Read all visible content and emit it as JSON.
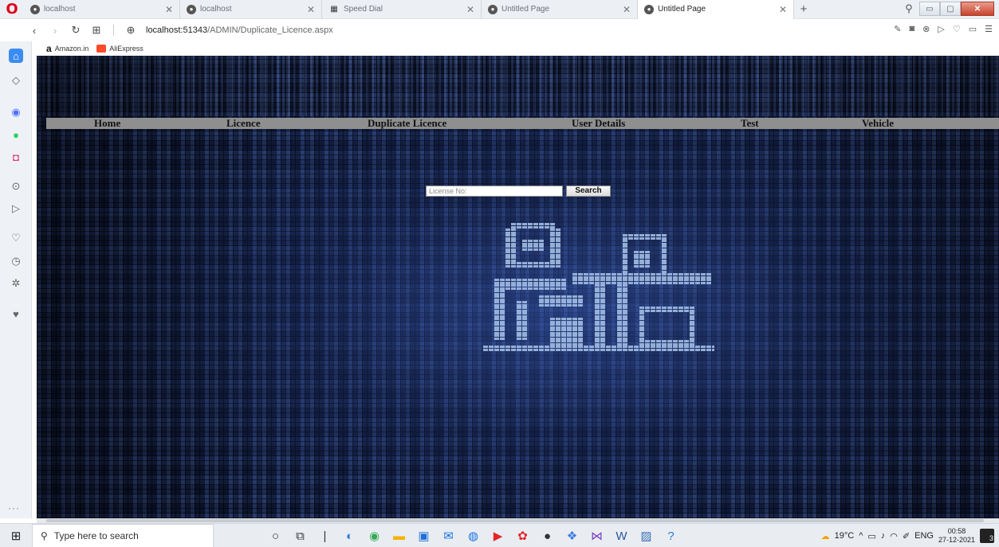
{
  "browser": {
    "tabs": [
      {
        "title": "localhost",
        "active": false
      },
      {
        "title": "localhost",
        "active": false
      },
      {
        "title": "Speed Dial",
        "active": false
      },
      {
        "title": "Untitled Page",
        "active": false
      },
      {
        "title": "Untitled Page",
        "active": true
      }
    ],
    "url_host": "localhost:51343",
    "url_path": "/ADMIN/Duplicate_Licence.aspx",
    "bookmarks": [
      "Amazon.in",
      "AliExpress"
    ]
  },
  "page": {
    "nav": [
      "Home",
      "Licence",
      "Duplicate Licence",
      "User Details",
      "Test",
      "Vehicle"
    ],
    "search": {
      "placeholder": "License No:",
      "button_label": "Search"
    }
  },
  "taskbar": {
    "search_placeholder": "Type here to search",
    "weather": "19°C",
    "language": "ENG",
    "time": "00:58",
    "date": "27-12-2021",
    "notifications": "3"
  },
  "colors": {
    "background": "#0c1426",
    "navbar": "#8f8f8f",
    "art_tile": "#a9c4ea"
  }
}
